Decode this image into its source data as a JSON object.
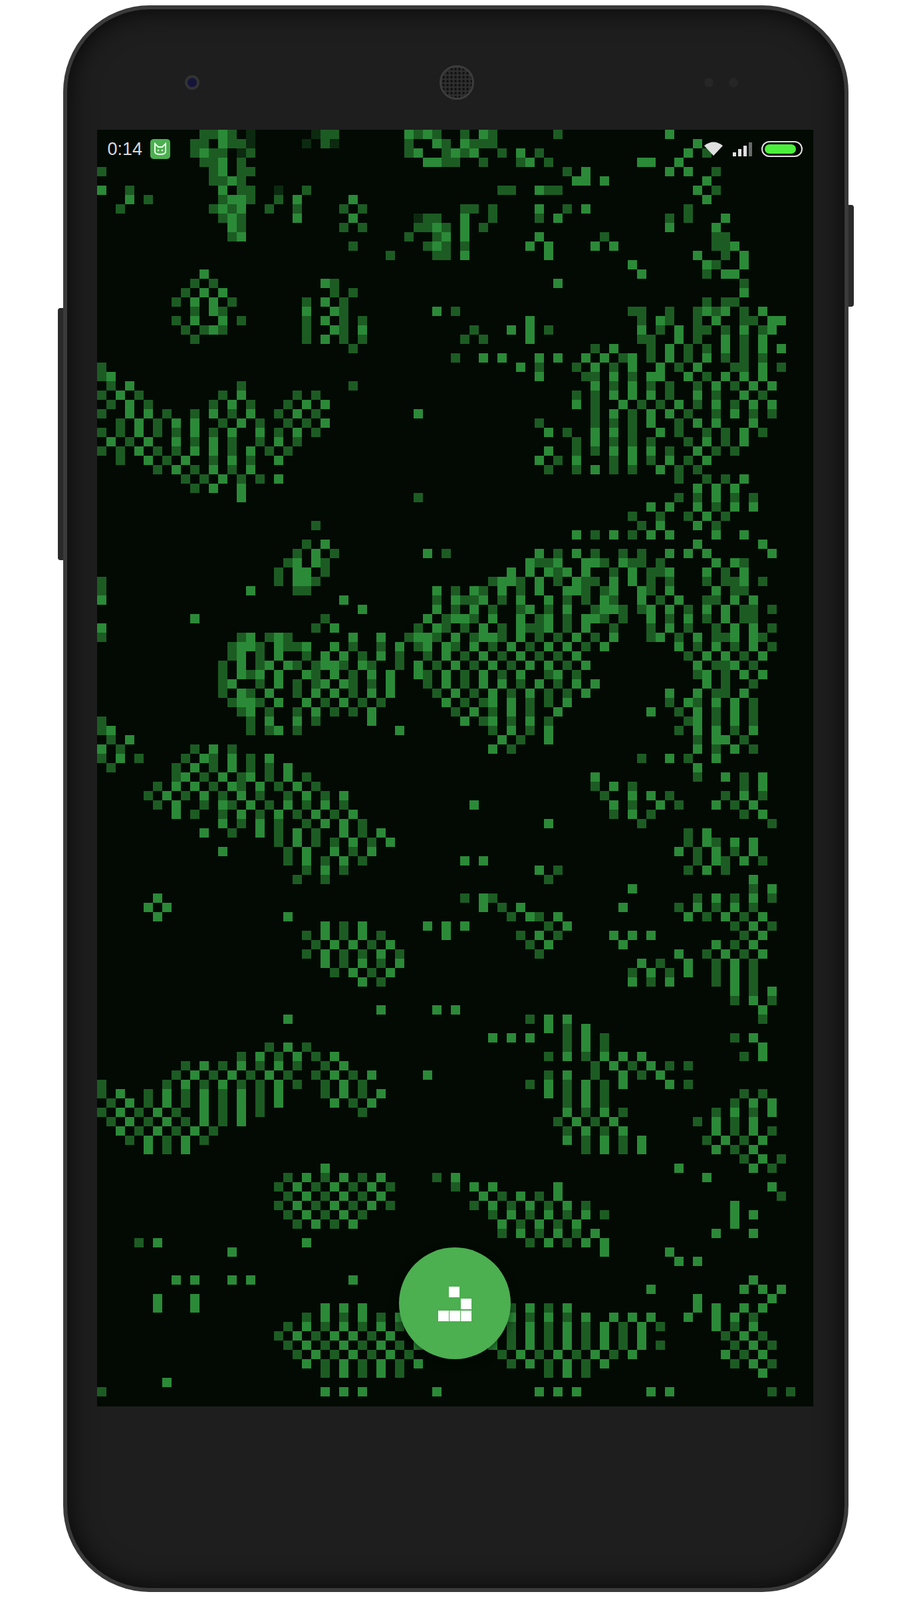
{
  "status_bar": {
    "time": "0:14",
    "wifi": {
      "level": 1
    },
    "signal": {
      "level": 0.75
    },
    "battery": {
      "level": 0.92
    }
  },
  "board": {
    "rows": [
      "...........2232.1......122.......3232..2.32......2...........3.....",
      "..........22.3221.....1.21.......2..32.3222.....................3..",
      "..........2322.12................23..2323..2.3.2...............3.2.",
      "...........223.2...................3322..2...23.2.........33..3....",
      "2...........23.22.................................2.3........3.3..2.",
      "............2232...................................33.3..........3..",
      "3..2.........3.22..1..2....................22..322..............3.2",
      "...3.2.......2332..2.3.....3.....................................3..",
      "..2.........2323..2..2....2.2..........22.2....3..2.3..........2....",
      ".............232.....3.....3......122..3..2....2.3...........2.2...3",
      "..............32..........2.2.....2232.3.2...................3....3",
      "..............23.................2..23.3.......3......2...........22.",
      "...........................2.......232.2......3.3....3.3..........223.",
      "...............................2....22.3........3...............3..2.3",
      ".........................................................3.......32..3",
      "...........3..............................................3......2.33.",
      "..........2.2...........32.......................3...................2",
      ".........2.3.3...........2.2.........................................3",
      "........2.3.3.2.......2.3.2......................................2.22.",
      "..........2.32........3..32.........3.2..................22..2..2323.2.3",
      "........2.3..3.2......2.3.2.2.................3...........2.32..2.3..22.33",
      ".........2.232........2..32.3...........2...3.3.2.........3.2.3.22.2.3.23",
      "..........2...........2.3.2.2..........2.2....3...........22..3.2..3.2.3.",
      "...........................2.........................2.3...2.3.2.2.3.2.3.3",
      "......................................2..3.3...3.3..3.3.23.2.3.2.3.2.2.2..",
      "2............................................3.2...2.3.2.3..3.2.3...22.3.2",
      "23.............................................3....22.3.2.33..3.2.3.3.3.",
      ".2.3...........2...........2.........................3.2.3.2.2..2.3.2.3.3",
      "2.3.2........2.3.....2.2...........................2.2.3.3.3.2..3.2..3.2.",
      ".2.3.2......2.3.2...2.3.3..........................3.2..3.2.2.3.2.3.2.3.3",
      "2..3.3.2..2.3.2.3..2.3.2..........3..................2.3.2.3.3.2..2.3.2.2",
      "..2.3.2.3.3..2.3.2..2.2.3......................2.....2.2.2.3..2.3.3...3.",
      "2.2.3.2.2.3.2.3..3.2.3.2........................3.2..3.3.2..3.2..2.2.3.2",
      ".3.2.3..3.2.3.2..2.3.2.............................2.3.2.2.2...2.3.2.3..",
      "2.2.3.2.2.3.3.2.3.2.2...........................3..2.2.3.3.3.2..3.2.2....",
      "..2..3.2.3..2.3.2..3...........................3.2.3...2.3.2.3.2.3......",
      "......2.3.2.3.2.3...............................2..2.3.2.2..3.2.2.......",
      ".........2.2.3.2.2.3..........................................2..2.2.3..",
      "..........2.3..3................................................3.3.3..",
      "...............3..................2...........................2.2.3.2.2.",
      "...........................................................3.3..3.2.3.3..",
      ".........................................................2..2..2.3.2.....",
      ".......................2..................................2.3...3.2......",
      "...................................................3.2.3.2.3.3....3..3..",
      "......................2.3.......................................3......3",
      ".....................2.3.2.........3.2.........3.2.3.2..2.2..3.3.3......3",
      "....................23.32.....................3223..332.322.2.....3.32..",
      "...................2.33.2...................3.3.323.3..2.3.223...3.2.3..",
      "2..................2.332..................2332.3.2.322.3.3.2.2...2.223.2",
      "2...............3....22.............3.2.32.3.2.3..332.23..32.3....3.22..",
      "3.........................3.........2.3223.2.3..3.2.2.32..3.2.3..22.3.3.",
      "............................3.......3.2.3.2..23.2.3..2332.23.3.2.3.3.22.2",
      "..........3.............2..........3.2332.3..3.23.2.332.2..3.2.3.2.3.22.",
      "3......................2.3........2.32.2.3.2.3223.2.3..2...2.3.2..2.3.3.2",
      "2..............23.232......3..3..2332.3.2332.3.2.2.3.2.3...23.2.3.223.32",
      "..............2332.3223..3.2..2.3.23.32.3.2.3.2.3.3.2.3.......3.2.3.2.3.2",
      "..............23.2.3..2.3.3.2.3.2..2.3.2.3.2.3.2.2.3...........2.3.3.2.3",
      ".............2.3.23.32.2332.32..2.3.2.3.2.3.2.3.3.2.3...........3.223.2.",
      ".............2.323.3..32.3.2.3.3..32.3.2.3.2.3..23.2............23.2.3.3",
      ".............23..2.3.2.23.32.2.3...2.3.2.3.3.2.3.2.3.3...........3.2..2",
      ".............2.32.3..2.3.3.2.3.3....2.3.2.3.2.3.2.2.3........3..3.22.3.",
      "..............2332.3..3.2.3.2.2......3.2.23.3.2.2.3..........2.32.3.3.2",
      "...............23.2..2.3.2.2.3........2.3.2.3.2..3.........3..2.3.2.3.2",
      "2...............2.3..3.2.....3.........3.23.2.3.2..............23.2.3.2",
      "23..............2.23.2..........3.........2.3.2.3.............2.3.3.2.3",
      ".2.3.......................................3.2..3...............2.33.2.",
      "3.2.......2.3.2...........................3.2...................3.2.3.2",
      "2.3.2....2.32.3.2.3.......................................2..3.2..3...",
      ".2......2.3.2.3.2.2.3...........................................3......",
      "........23.2.3.23.2.3.2..............................3..........2..3.2.3",
      "......2.3.3.2.32.3.2.3.2.............................2.3.2...........2.3",
      ".....2.3.2.3.2.3.2..2.3.2.3...........................2..3.3.2.....2.3.2",
      "......2.3..2.32.3.2.3.2.3.2.............3..............3.2..3.2...3.2.3.",
      "........3.2..2.3.2.3.2.3.2.3...........................2.3.2.........2.3",
      ".............3.2.3.2..2.3.3.2...................3.........2.............2",
      "...........3..2..3.2.3.2..3.2.3................................2.3......",
      "...................2.3.2.2.3.2.3...............................2.32.3.3",
      ".............3......2.3..3.2.3................................3.2.3.2.3.",
      "....................2.3.2.3.2..........3.3......................2.32.3.2",
      "......................2.3.2....................3.2.............2.3.2...",
      ".....................2..2.......................2.....................3",
      ".........................................................3............2.3",
      "......3................................2.32.....................2.3.2.3.2",
      ".....3.3.................................3.2.3..........3.....2.3.2.3.2.",
      "......3.............3.......................2.32.3.............3.2.3.2.3",
      "........................3.2.3......3.3.3........2.3.................2.3.2",
      "......................2.3.2.3.2......3.......2.3.2.....3.3.3.........2.3",
      ".......................2.3.3.2.3..............2.3.......3.........3.2.3.",
      "......................2.3.2.2.3.2..............2..............3..2.3.2.3",
      "........................3.2.3.2.3.........................3.2..3..2.3.2..",
      ".........................2.3.2.3.........................2.3.2.3..2.3.2",
      "............................3.2..........................3.2.3....2.3.2.",
      "....................................................................3.2.3",
      "....................................................................2.3.2",
      "..............................3.....3.3................................3",
      "....................3.........................2.3.3....................2",
      "................................................3.2.3...................",
      "..........................................3.3.3...2.3.2.............2.3",
      "..................2.3.2...........................2.3.2................3",
      "...............2.3.2.3.2.3......................2.3.2.3.3.3..........2.3",
      ".........2.3.2.3.2.3.2..2.3..........................2.3.2.3.2.2........",
      "........2.3.2.3.2.3.2..2.3.2.3.....3............2.3..2..3.2.3............",
      "2......2.3.2.3.2.2.3.2..2.3.2.................2.3.2.3.2.3....3.2........",
      "2.3..2.3.2.3.2.3.2.3....2.3.2.3.................3.2.3.2..............2.2",
      ".2.3.2.3.2.3.2.3.2.3.....3.2.3....................2.3.2.............2.3.3",
      "2.3.2.3.2..3.2.3.2..........2.....................3.2.3.2.........2.3.2.3",
      ".2.3.2.3.2.3.2.3.................................2.3.2.3........2.3.2.3.",
      "..3.2.3.2.3.2.....................................2.3.2.3.........3.2.3.2",
      "...2.3.2.3.2......................................3.2.3.2.3......2.3.2.3",
      ".....3.2.3..........................................2.3.2.3.......3.2.3.",
      ".....................................................................2.3.2",
      "........................3.....................................3.......3.2",
      "....................2.3.2.3.2.3.....2.3..........................3.......",
      "...................2.3.2.3.2.3.2......2.3.3......3......................3",
      "....................2.3.2.3.2.3..........3.2.3.2.3.......................2",
      "...................2.3.2.3.2.3.2........2.3.2.3.2.3.2...............3....",
      "....................2.3.2.3.2.............2.3.2.3.2.3.2.............3.3..",
      ".....................2.3.2.3...............3.2.3.2.3................3.....",
      "...........................................2.3.2.3.2.3............3...3..",
      "....2.3...............3.......................2.3.2.3.3...................",
      "..............3.......................................3......3.............",
      "..............................................................3.3.........",
      "...........................................................................",
      "........3.3...3.3..........3..........................................3.....",
      "...........................................................3.........3.3.3.",
      "......3...3.....................................................3.......3.",
      "......3...3.............3.3.3...............2.3.2.3.............3.3..3.3..",
      "......................2.3.2.3.2.3.........2.3.2.3.2.3..3.3.3...3..3.3.2..",
      "....................2.3.2.3.2.3.2.......2.3.2.3.2.3.2.3.2.3.2.....3.2.3..",
      "...................2.3.2.3.3.2.3........2.3.2.3.2.3.2.3.2.3........2.3.2.",
      "....................2.3.2.3.2.3.2.3.......3.2.3.2.3.2.3.2.3.2.......2.3.2",
      ".....................2.3.2.3.2.3.2.........2.3.2.3.2.3.2.3.........3.2.3",
      "......................3.2.3.2.3.2.3.........2.3.2.3.2.3.............2.3.2",
      "........................2.3.2.3.2...............2.3.2..................3.",
      ".......3................................................................",
      "2.......................3.3.3.......3..........3.3.3.......3.3..........2.2",
      ".........................................................................."
    ]
  }
}
